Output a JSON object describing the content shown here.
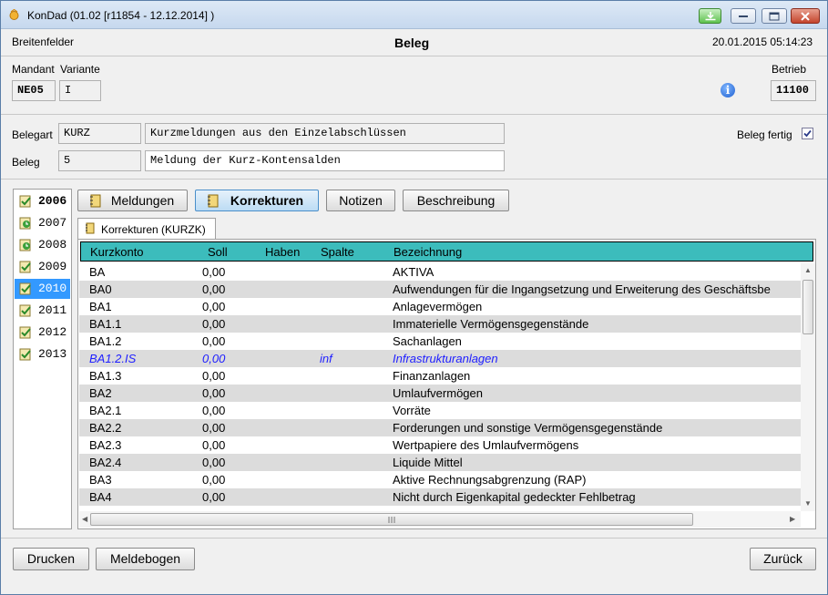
{
  "window": {
    "title": "KonDad (01.02 [r11854 - 12.12.2014] )"
  },
  "header": {
    "left": "Breitenfelder",
    "center": "Beleg",
    "right": "20.01.2015 05:14:23"
  },
  "context": {
    "mandant_label": "Mandant",
    "variante_label": "Variante",
    "betrieb_label": "Betrieb",
    "mandant_value": "NE05",
    "variante_value": "I",
    "betrieb_value": "11100"
  },
  "beleg": {
    "belegart_label": "Belegart",
    "belegart_code": "KURZ",
    "belegart_text": "Kurzmeldungen aus den Einzelabschlüssen",
    "beleg_label": "Beleg",
    "beleg_code": "5",
    "beleg_text": "Meldung der Kurz-Kontensalden",
    "fertig_label": "Beleg fertig",
    "fertig_checked": true
  },
  "years": [
    {
      "label": "2006",
      "selected": false,
      "bold": true,
      "icon": "doc-check-icon"
    },
    {
      "label": "2007",
      "selected": false,
      "bold": false,
      "icon": "doc-clock-icon"
    },
    {
      "label": "2008",
      "selected": false,
      "bold": false,
      "icon": "doc-clock-icon"
    },
    {
      "label": "2009",
      "selected": false,
      "bold": false,
      "icon": "doc-check-icon"
    },
    {
      "label": "2010",
      "selected": true,
      "bold": false,
      "icon": "doc-check-icon"
    },
    {
      "label": "2011",
      "selected": false,
      "bold": false,
      "icon": "doc-check-icon"
    },
    {
      "label": "2012",
      "selected": false,
      "bold": false,
      "icon": "doc-check-icon"
    },
    {
      "label": "2013",
      "selected": false,
      "bold": false,
      "icon": "doc-check-icon"
    }
  ],
  "toptabs": {
    "meldungen": "Meldungen",
    "korrekturen": "Korrekturen",
    "notizen": "Notizen",
    "beschreibung": "Beschreibung"
  },
  "subtab": {
    "label": "Korrekturen (KURZK)"
  },
  "table": {
    "headers": {
      "kurzkonto": "Kurzkonto",
      "soll": "Soll",
      "haben": "Haben",
      "spalte": "Spalte",
      "bezeichnung": "Bezeichnung"
    },
    "rows": [
      {
        "kurzkonto": "BA",
        "soll": "0,00",
        "haben": "",
        "spalte": "",
        "bezeichnung": "AKTIVA"
      },
      {
        "kurzkonto": "BA0",
        "soll": "0,00",
        "haben": "",
        "spalte": "",
        "bezeichnung": "Aufwendungen für die Ingangsetzung und Erweiterung des Geschäftsbe"
      },
      {
        "kurzkonto": "BA1",
        "soll": "0,00",
        "haben": "",
        "spalte": "",
        "bezeichnung": "Anlagevermögen"
      },
      {
        "kurzkonto": "BA1.1",
        "soll": "0,00",
        "haben": "",
        "spalte": "",
        "bezeichnung": "Immaterielle Vermögensgegenstände"
      },
      {
        "kurzkonto": "BA1.2",
        "soll": "0,00",
        "haben": "",
        "spalte": "",
        "bezeichnung": "Sachanlagen"
      },
      {
        "kurzkonto": "BA1.2.IS",
        "soll": "0,00",
        "haben": "",
        "spalte": "inf",
        "bezeichnung": "Infrastrukturanlagen",
        "highlight": true
      },
      {
        "kurzkonto": "BA1.3",
        "soll": "0,00",
        "haben": "",
        "spalte": "",
        "bezeichnung": "Finanzanlagen"
      },
      {
        "kurzkonto": "BA2",
        "soll": "0,00",
        "haben": "",
        "spalte": "",
        "bezeichnung": "Umlaufvermögen"
      },
      {
        "kurzkonto": "BA2.1",
        "soll": "0,00",
        "haben": "",
        "spalte": "",
        "bezeichnung": "Vorräte"
      },
      {
        "kurzkonto": "BA2.2",
        "soll": "0,00",
        "haben": "",
        "spalte": "",
        "bezeichnung": "Forderungen und sonstige Vermögensgegenstände"
      },
      {
        "kurzkonto": "BA2.3",
        "soll": "0,00",
        "haben": "",
        "spalte": "",
        "bezeichnung": "Wertpapiere des Umlaufvermögens"
      },
      {
        "kurzkonto": "BA2.4",
        "soll": "0,00",
        "haben": "",
        "spalte": "",
        "bezeichnung": "Liquide Mittel"
      },
      {
        "kurzkonto": "BA3",
        "soll": "0,00",
        "haben": "",
        "spalte": "",
        "bezeichnung": "Aktive Rechnungsabgrenzung (RAP)"
      },
      {
        "kurzkonto": "BA4",
        "soll": "0,00",
        "haben": "",
        "spalte": "",
        "bezeichnung": "Nicht durch Eigenkapital gedeckter Fehlbetrag"
      }
    ]
  },
  "footer": {
    "drucken": "Drucken",
    "meldebogen": "Meldebogen",
    "zurueck": "Zurück"
  },
  "colors": {
    "table_header": "#3cbcbc",
    "selection": "#3399ff",
    "highlight_text": "#2020ff"
  }
}
